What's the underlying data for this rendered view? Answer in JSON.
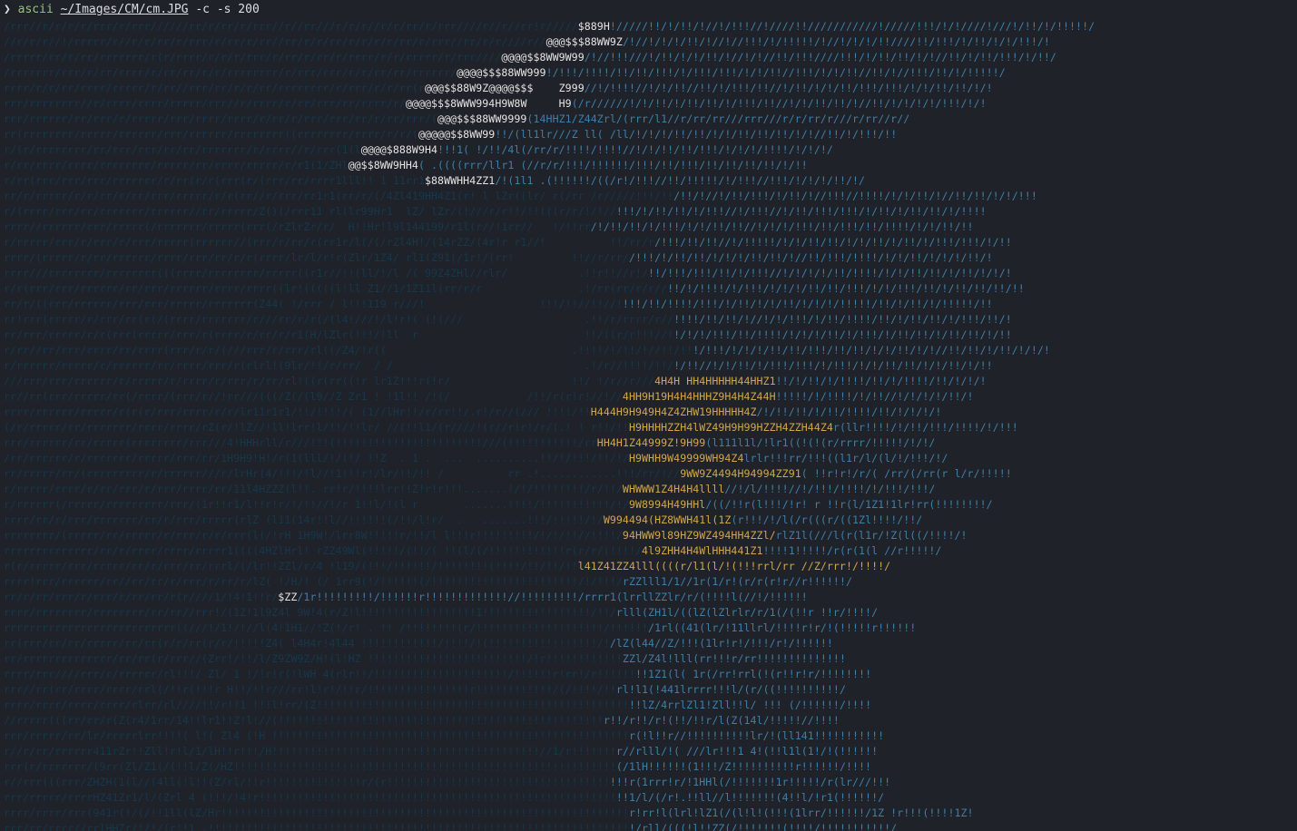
{
  "prompt": {
    "symbol": "❯",
    "command": "ascii",
    "path": "~/Images/CM/cm.JPG",
    "args": "-c -s 200"
  },
  "art_rows": [
    {
      "d": "/rrr//r/r/r/r/rrr/r/rrr//////rr/r/rr/r/rrr//r//rr///r/r/r//r/r/rr/r/rrr////r//r//rr!r/////",
      "w": "$889H",
      "b": "!/////!!/!/!!/!//!/!!!//!////!!///////////!/////!!!/!/!////!///!/!!/!/!!!!!/"
    },
    {
      "d": "//r/r/r//!/rrrrr/r//r/r/rr/r/rrr/r/rr/r/rr//rr/r/r/rr/r/r/r/r/rr/r/rrr//rr/r/r////r//",
      "w": "@@@$$$88WW9Z",
      "b": "/!//!/!/!/!!/!//!//!!!/!/!!!!!/!//!/!/!/!!////!!/!!!/!/!!/!/!/!!!/!"
    },
    {
      "d": "/rrrrr/rr/r/rr/rrrrrrr/r(r/rrrr/r/r/r/rrr/r/rr/r/rr/r/rrrr/r/r/rrrrr/r/rrr////",
      "w": "@@@@$$8WW9W99",
      "b": "/!//!!!///!/!!/!/!/!!/!//!/!//!!/!!!////!!!/!/!!/!!/!/!//!!/!/!!/!!!/!/!!/"
    },
    {
      "d": "/rrrrrrr/rrr/r/rr/rrrr/r/rr/rr/r/r/rrrrrrrr/r/rrr/rrr/r/r/rr/rr/rrrrrr/",
      "w": "@@@@$$$88WW999",
      "b": "!/!!!/!!!!/!!/!!/!!!/!/!!!/!!!/!/!/!!//!!!/!/!/!!//!!/!//!!!/!!/!/!!!!!/"
    },
    {
      "d": "rrrr/r/r/rr/rrrr/rrrrr/r/rr//rrr/rr/r/r/rr/rrrrrrrr/r/rrr/r/r/rr(r",
      "w": "@@@$$88W9Z@@@@$$$    Z999",
      "b": "//!/!!!!//!/!/!!//!!/!/!!!/!!//!/!!/!/!/!!/!!!/!!!/!/!/!!/!!/!/!"
    },
    {
      "d": "rrr/rrrrrrrr//r/rrrr/rrrr/rrrrr/rrr//r/rrrr/r/rr/rrr/rr/rrrr/r/",
      "w": "@@@@$$$8WWW994H9W8W     H9",
      "b": "(/r//////!/!/!!/!/!!/!!/!/!!!/!!//!/!/!!/!!/!//!!/!/!/!/!/!!!/!/!"
    },
    {
      "d": "rrr/rrrrrr/rr/rrr/r/rrrrr/rrr/rrrr/rrrr/r/rr/r/rrr/rrr/rr/r/rr/rrr/(",
      "w": "@@@$$$88WW9999",
      "b": "(14HHZ1/Z44Zrl/(rrr/l1//r/rr/rr///rrr///r/r/rr/r///r/rr//r//"
    },
    {
      "d": "rr(rrrrrrrr/rrrrr/rrrrrr/rrr/rrrrrr/rrrrrrrr((rrrrrrrr/rrrr/r/r/(",
      "w": "@@@@@$$8WW99",
      "b": "!!/(ll1lr///Z ll( /ll/!/!/!/!!/!!/!/!/!!/!!/!!/!/!//!!/!/!!!/!!"
    },
    {
      "d": "r/(r/rrrrrrrr/rr/rrr/rrr/rr/rr/rrrrrrr/r/rrrr//r/rrr(1(l",
      "w": "@@@@$888W9H4",
      "b": "!!!1( !/!!/4l(/rr/r/!!!!/!!!!//!/!/!!/!!/!!!/!/!/!/!!!!/!/!/!/"
    },
    {
      "d": "r/rr/rrrr/rrrr/rrrrrrrr/rrrrr/rr/rrrr/rrrrr/r/r1(1/ZHl",
      "w": "@@$$8WW9HH4",
      "b": "( .((((rrr/llr1 (//r/r/!!!/!!!!!!/!!!/!!/!!!/!!/!!/!!/!!/!/!!"
    },
    {
      "d": "r/rr(rrr/rrr/rrr/rrrrrrr/r/rr(r/r(rrr(r/(rrr/rr/rrrr1lll!! 1 11rr1",
      "w": "$88WWHH4ZZ1",
      "b": "/!(1l1 .(!!!!!!/((/r!/!!!//!!/!!!!!/!/!!!//!!!/!/!/!/!!/!/"
    },
    {
      "d": "rr/r/rrrrr/r/r/rr/r/rr/rrr/rrrrr/r/r(rr//r/rrr/rr1r1(rr/r/(/4Zl419HH4Z1(r! l lZr((lr/ r(/rr /r/////!!!/!!",
      "w": "",
      "b": "/!!/!//!/!!/!!!/!/!!/!//!!!//!!!!/!/!/!!/!//!!/!!/!/!/!!!"
    },
    {
      "d": "r/(rrrr/rrr/rr/rrrrrrr/rrrrrr//rr/rrrrr/Z()(/rrr11 rl(lr99Hr1  lZ/ lZr/(!///r/r!!/!!(((r/r/!/!//",
      "w": "",
      "b": "!!!/!/!!/!!/!/!!!//!/!!!//!/!!/!!!/!!!/!/!!/!/!!/!!/!/!!!!"
    },
    {
      "d": "rrrr//rrrrrr/rrr/rrrrr(/rrrrrrr/rrrrr(rrr(/rZlrZr/r/  H!!Hr!l9l144199/r1l(r//!1rr//   !/!!rr",
      "w": "",
      "b": "/!/!!/!!/!/!!!/!/!/!!/!!//!/!/!/!!!/!!/!!!/!!/!!!!/!/!/!!/!!"
    },
    {
      "d": "r/rrrrr/rrr/r/rrr/r/rrr/rrrrr(rrrrrr//(rrr/r/rr/r(rr1r/l(/(/rZl4H!/(14rZZ/(4r!r r1//!          !!/rr/r",
      "w": "",
      "b": "/!!!/!!/!!//!/!!!!!/!/!/!!/!!/!/!/!!/!/!!/!/!!!/!!!/!/!!"
    },
    {
      "d": "rrrr/(rrrrr/r/rr/rrrrrr/rrrr/rrr/rr/r/r(rrrr/lr/l/r!r(Zlr/1Z4/ rl1(Z91(/1r!/(rr!         !!//r/rr/",
      "w": "",
      "b": "/!!!/!/!!/!!/!/!/!/!!/!!/!//!!/!!!/!!!!/!/!/!!/!/!/!/!!/!"
    },
    {
      "d": "rrrr///rrrrrrrr/rrrrrrrr(((rrrr/rrrrrrrr/rrrrr((r1r//!!(ll/!/l /( 99Z4ZHl//rlr/           .!!r!!//r!/",
      "w": "",
      "b": "!!/!!!/!!!/!!/!/!!!//!/!/!/!/!!/!!!!/!/!/!!/!!/!/!!/!/!/!"
    },
    {
      "d": "r/r(rrr/rrr/rrrrrr/rr/rrr/rrrrrr/rrrr/rrrr((lr!(((((l!ll Z1//1/1Z11l(rr/r/r               .!/rr(rr/r/r//",
      "w": "",
      "b": "!!/!/!!!!/!/!!!/!/!/!/!!/!!/!!!/!/!/!!!/!!/!/!!/!!/!!/!!"
    },
    {
      "d": "rr/r/((rrr/rrrrrr/rrr/rrr/rrrrr/rrrrrrr(Z44( !/rrr / l!!!119 r///!                  !!!/!!//!!//!",
      "w": "",
      "b": "!!!/!!/!!!!/!!!/!/!!/!/!/!!/!/!/!/!!!!!/!!/!/!!/!/!!!!!/!!"
    },
    {
      "d": "rr!rrr(rrrrr/r/rrr/rr(r(/(rrrr/rrrrrrr/r///rr/r/r(/(l4!///!/l!r!( (!(///                   .!!/r/rrrr/r//",
      "w": "",
      "b": "!!!!/!!/!!/!//!/!/!!!/!/!!/!!!!/!!/!/!!/!!/!/!!!/!!/!"
    },
    {
      "d": "rr/rrr/rrrrr/r/r(rrr(rrrrr/rrr/r(rrrr/r/rr/r/r1(H/lZlr(!!!/!ll  r                          !!/((r/r!!!//!",
      "w": "",
      "b": "!/!/!/!!!/!!/!!!!/!/!/!/!!/!/!!!/!/!!/!!/!/!!/!!/!/!!"
    },
    {
      "d": "r/rr//rr/rrr/rrrr/rr/rrrr(rrr/r/r/(///rrr/r/rrr/rl((/Z4/!r((                             .!!!!/!/!!/!//!!/!!",
      "w": "",
      "b": "!/!!!/!/!/!/!!/!!/!!!/!!/!!/!/!/!!/!/!//!!/!!/!/!!/!/!/!"
    },
    {
      "d": "r/rrrrrr/rrrrr/r/rrrrrr/rr/rrrr/rrr/r(rlrl!(9lr/!!/r/rr/  / /                              .!/r//!!!!/!!/",
      "w": "",
      "b": "!/!!//!/!/!!/!/!!!/!!!/!/!!!/!/!/!!/!!/!/!/!!/!/!!"
    },
    {
      "d": "///rrr/rrr/rrrrrr/r/rrrrr/r/rrrr/r/rrr/r/rr/rl!((r(rr((!r lr1Z!!!r(!r/                   !!/ !/r//r///",
      "y": "4H4H HH4HHHHH44HHZ1",
      "b": "!!/!/!!/!/!!!!/!!/!/!!!!/!!/!/!/!"
    },
    {
      "d": "rr//rr(rrr/rrrrr/rr(/rrrr/(rrr/r//!rr///(((/Z(/(l9//Z Zr1 ! !1l!! /!(/            /!!/r(r!r!//!//",
      "y": "4HH9H19H4H4HHHZ9H4H4Z44H",
      "b": "!!!!!/!/!!!!/!/!!//!/!/!/!/!!/!"
    },
    {
      "d": "rrrr/rrrrrr/rrrrr/r(r(r/rrr/rrrr/r/r/lr11r1r1/!!/!!!!/( (1//lHr!!/r/rr!!/.r!/r//(/// !!!!/!!",
      "y": "H444H9H949H4Z4ZHW19HHHHH4Z",
      "b": "/!/!!/!!/!/!!/!!!!/!!/!/!/!/!"
    },
    {
      "d": "(/r/rrrrr/rr/rrrrrrr/rrrr/rrrr/rZ(r/!lZ//!ll!lrr!l/!!/!!lr/ //(!!l1/(r////!(r//r!r!/r/(.! ! r!!/!!",
      "y": "H9HHHHZZH4lWZ49H9H99HZZH4ZZH44Z4",
      "b": "r(llr!!!!/!/!!/!!!/!!!!/!/!!!"
    },
    {
      "d": "rrr/rrrrrr/rr/rrrrr(rrrrrrrr/rrr///4!HHHrll/r///!!!(!!!!!!!!!!!!!!!!!!!!!!!///(!!!!!!!!!!!/rr",
      "y": "HH4H1Z44999Z!9H99",
      "b": "(l111l1l/!lr1((!(!(r/rrrr/!!!!!/!/!/"
    },
    {
      "d": "/rr/rrrrrr/r/rrrrrrr/rrrrr/rrr/rr/1H9H9!H!/r(1(lll/!/(!/ !!Z  . 1 .  ...  ..........!!/!/!!!/!!/!/",
      "y": "H9WHH9W49999WH94Z4",
      "b": "lrlr!!!rr/!!!((l1r/l/(l/!/!!!/!/"
    },
    {
      "d": "rr/rrrrr/rr/(rrrrrrrrr/r/rrrrrr///r/lrHr(4/!!!/!l//!1!!!r!/lr/!!/!! /          rr .!............!!!/rr/!//",
      "y": "9WW9Z4494H94994ZZ91",
      "b": "( !!r!r!/r/( /rr/(/rr(r l/r/!!!!!"
    },
    {
      "d": "r/rrrrr/rrrr/r/rr/rrr/r/rrr/rrrr/rr/11l4HZZZ(l!!. rr!r/!!!!lrr!!Z!r!r!!!.......!/!/!!!!!!!!/r/!!/",
      "y": "WHWWW1Z4H4H4llll",
      "b": "//!/l/!!!!//!/!!!/!!!!/!/!!!/!!!/"
    },
    {
      "d": "r/rrrrrr(/rrrrr/rrrrrrrrr/rrr/(1r!!r1/l!!r!r/!/!!//!/r 1!!l/!(l r       .......!!!!/!!!!!!!!!!!/!/",
      "y": "9W8994H49HHl",
      "b": "/((/!!r(l!!!/!r! r !!r(l/1Z1!1lr!rr(!!!!!!!!/"
    },
    {
      "d": "rrrr/rr/r/rrr/rrrrrrr/rr/r/rrr/rrrrr(rlZ (l11(14r!!l//!!!!!!(/!!/l!r/  .   .......!!!/!!!!!/!/",
      "y": "W994494(HZ8WWH41l(1Z",
      "b": "(r!!!/!/l(/r(((r/((1Zl!!!!/!!/"
    },
    {
      "d": "rrrrrrrr/(rrrrr/rr/rrrrr/r/rrr/r/r/rrr(l(/!rH 1H9W!/lrr8W!!!!!r/!!/l l!!!r!!!!!!!!!/!/!/!!//!!!!/",
      "y": "94HWW9l89HZ9WZ494HH4ZZl/",
      "b": "rlZ1l(///l(r(l1r/!Z(l((/!!!!/!"
    },
    {
      "d": "rrrrrrrrrrrrrr/rr/r/rrrr/rrrr/rrrrr1((((4HZlHrl! rZZ49Wl(!!!!!/(!!/( !!(l/(/!!!!!!!!!!!!r(r/r/(!!!!/",
      "y": "4l9ZHH4H4WlHHH441Z1",
      "b": "!!!!1!!!!!/r(r(1(l //r!!!!!/"
    },
    {
      "d": "r(r/rrrrr/rrr/rrrrr/rr/r/rrr/rr/rrrl/(/lr!!ZZl/r/4 !l19/(!!!/!!!!!!/!!!!!!!!(!!!!/!!/!!/!!",
      "y": "l41Z41ZZ4lll((((r/l1(l/!(!!!rrl/rr //Z/rrr!/!!!!/",
      "b": ""
    },
    {
      "d": "rrrr!rrr/rrrrrr/rr//rr/rr/r/rrr/r/rr/r/lZ( !/H/! (/ 1rr9(!/!!!!!!(/!!!!!!!!!!!!!!!!!!!!!!!/!/!!!/",
      "y": "",
      "b": "rZZlll1/1//1r(1/r!(r/r(r!r//r!!!!!!/"
    },
    {
      "d": "rr/r/rr/rrr/r/rrr/r/rr/rr/r(r////1/!4!1!!r/",
      "w": "$ZZ",
      "b": "/1r!!!!!!!!!/!!!!!!r!!!!!!!!!!!!!//!!!!!!!!!/rrrr1(lrrllZZlr/r/(!!!!l(//!/!!!!!!"
    },
    {
      "d": "rrrr/rrrrrrrr/rrrrrrrr/rr/rr//rrr!/(1Z!1l9Z4l 9W!4(r/Z!l!!!!!!!!!!!!!!!!!!1!!!!!!!!!!!!!!!!!/!!/",
      "y": "",
      "b": "rlll(ZH1l/((lZ(lZlrlr/r/1(/(!!r !!r/!!!!/"
    },
    {
      "d": "rrrrrrrrrrrrrrrrrrrrrrrrrrr((///!/1!/!//l(4!1H1//!Z(!/r! . !! /!!!!!!!!(r/!!!!!!!!!!!!!!!!!!!!/!!!!!!",
      "y": "",
      "b": "/1rl((41(lr/!11llrl/!!!!r!r/!(!!!!!r!!!!!!"
    },
    {
      "d": "rr(rrr/rr/rr/rrrrr/rr/rr(r/r/rr(r/r/!!!!!Z4( l4H4r!4l44 !!!!!!!!!!!!/!!!!/!(!!!!!!!!!!!!!!!!!/!",
      "y": "",
      "b": "/lZ(l44//Z/!!!(1lr!r!/!!!/r!/!!!!!!"
    },
    {
      "d": "rr/rrrrrrrrrrrrrr/rr/rr(r/rrr//(Zrr!/!!/l/Z9ZW9Z/H!(l!HZ !!!!!!!!!!!!!!!!!!!!!!!!!/!r!!!!!!!!!!!!",
      "y": "",
      "b": "ZZl/Z4l!lll(rr!!!r/rr!!!!!!!!!!!!!!"
    },
    {
      "d": "rrrr/rrr////rrr/r/rrrrrr/rl!!!/ Zl/ 1 !/!r!r(!lWH 4(rlr!!/!!!!!!!!!!!!!!!!!!!!!/!!!!!!r!rr!/r!!!!!!",
      "y": "",
      "b": "!!1Z1(l( 1r(/rr!rrl(!(r!!r!r/!!!!!!!!"
    },
    {
      "d": "rrr//rr(rr/rrrr/rrrr/rrl(/!!r(!!!r H!!/!!r///rr!l!r!/!!r/!!!!!!!!!!!!!!!!r!!!!!!!!!!!!/(/!!!!/!!",
      "y": "",
      "b": "rl!l1(!441lrrrr!!!l/(r/((!!!!!!!!!!/"
    },
    {
      "d": "rrrr/rrrr/rrrr/rrrr/rlrr/rl////!!/r!!1 !!!l!rr/(Z!!!!!!!!!!!!!!!!!!!!!!!!!!!!!!!!!!!!!!!!!!!!!!!!!",
      "y": "",
      "b": "!!lZ/4rrlZl1!Zll!!l/ !!! (/!!!!!!/!!!!"
    },
    {
      "d": "//rrrrr(((rr/rr/r(Z(r4/1rr/14!!lr1!!Z!l!//(!!!!!!!!!!!!!!!!!!!!!!!!!!!!!!!!!!!!!!!!!!!!!!!!!!!",
      "y": "",
      "b": "r!!/r!!/r!(!!/!!r/l(Z(14l/!!!!!//!!!!"
    },
    {
      "d": "rrr/rrrrr/rr/lr/rrrrrlrr!!!!( l!( Zl4 (!H !!!!!!!!!!!!!!!!!!!!!!!!!!!!!!!!!!!!!!!!!!!!!!!!!!!!!!!!",
      "y": "",
      "b": "r(!l!!r//!!!!!!!!!!lr/!(ll141!!!!!!!!!!!"
    },
    {
      "d": "r//r/rr/rrrrrr411rZr!!Zll!r!l/1/lH!!r!!!/H!!!!!!!!!!!!!!!!!!!!!!!!!!!!!!!!!!!!!!!!!!//1/r!!!!!!!",
      "y": "",
      "b": "r//rlll/!( ///lr!!!1 4!(!!l1l(1!/!(!!!!!!"
    },
    {
      "d": "rrr(r/rrrrrrr/(9rr(Zl/Z1(/(!!l/Z(/HZ!!!!!!!!!!!!!!!!!!!!!!!!!!!!!!!!!!!!!!!!!!!!!!!!!!!!!!!!!!!!",
      "y": "",
      "b": "(/1lH!!!!!!(1!!!/Z!!!!!!!!!!r!!!!!!/!!!!"
    },
    {
      "d": "r//rrr(((rrr/ZHZH(1(l//(4ll(!l!!(Z/rl/!!r!!!!!!!!!!!!!!!r/(r!!!!!!!!!!!!!!!!!!!!!!!!!!!!!!!!!!!",
      "y": "",
      "b": "!!!r(1rrr!r/!1HHl(/!!!!!!!1r!!!!!/r(lr///!!!"
    },
    {
      "d": "rrr/rrrrr/rrrrHZ41Zr1/l/(Zrl 4 (!!!/!4!r!!!!!!!!!!!!!!!!!!!!!!!!!!!!!!!!!!!!!!!!!!!!!!!!!!!!!!!!",
      "y": "",
      "b": "!!1/l/(/r!.!!ll//l!!!!!!!(4!!l/!r1(!!!!!!/"
    },
    {
      "d": "rrrr/rrrr/rrr(941r(!/(/!!1ll(lZ/Hr!!!!!!!!!!!!!!!!!!!!!!!!!!!!!!!!!!!!!!!!!!!!!!!!!!!!!!!!!!!!!!!!",
      "y": "",
      "b": "r!rr!l(lrl!lZ1(/(l!l!(!!!(1lrr/!!!!!!/1Z !r!!!(!!!!1Z!"
    },
    {
      "d": "rrr/rr/rrrr//rrlHHZr/!/!/(r!!1 .!!!!!!!!!!!!!!!!!!!!!!!!!!!!!!!!!!!!!!!!!!!!!!!!!!!!!!!!!!!!!!!!!!",
      "y": "",
      "b": "!/rll/(((!l!!ZZ(/!!!!!!!(!!!!/!!!!!!!!!!!/"
    }
  ]
}
